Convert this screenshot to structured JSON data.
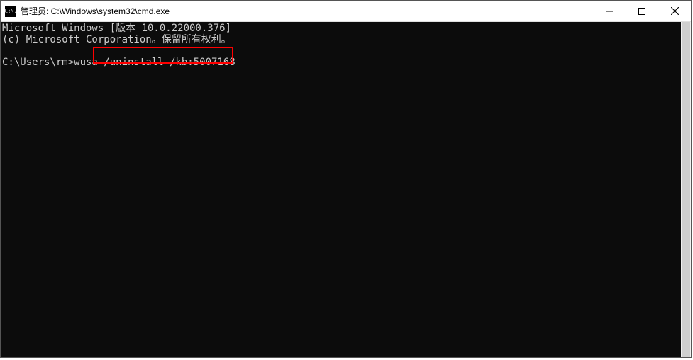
{
  "titlebar": {
    "icon_label": "C:\\.",
    "title": "管理员: C:\\Windows\\system32\\cmd.exe"
  },
  "console": {
    "line1": "Microsoft Windows [版本 10.0.22000.376]",
    "line2": "(c) Microsoft Corporation。保留所有权利。",
    "blank": "",
    "prompt_line": "C:\\Users\\rm>wusa /uninstall /kb:5007168",
    "highlighted_segment": "/uninstall /kb:5007168"
  },
  "highlight": {
    "color": "#ff0000"
  }
}
